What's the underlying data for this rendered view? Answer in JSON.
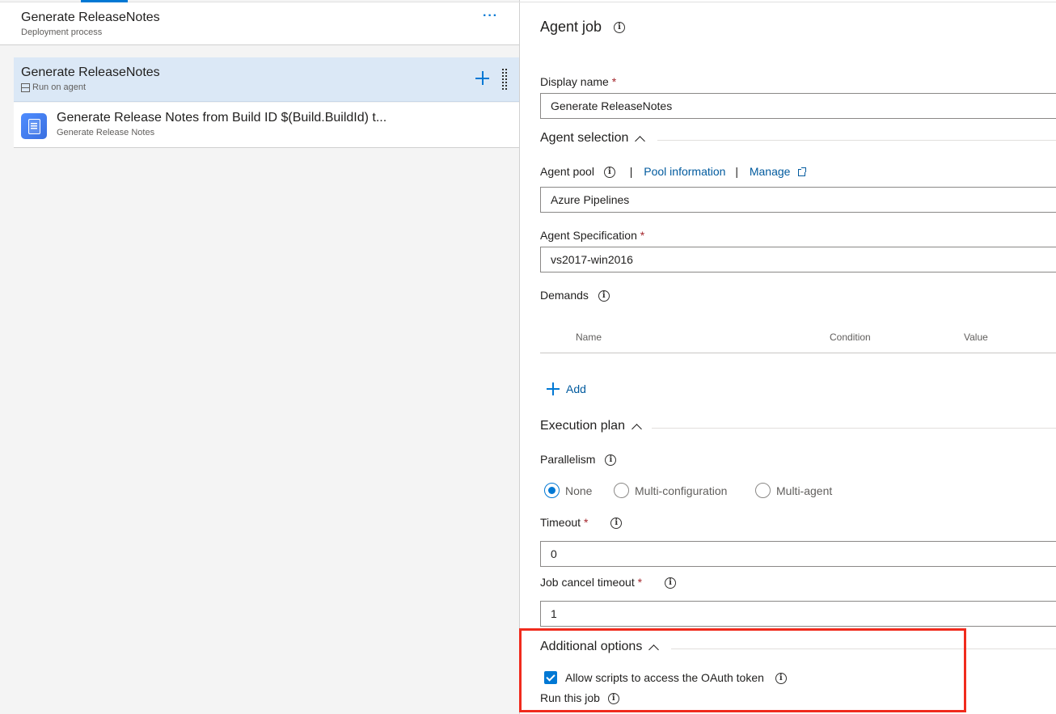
{
  "left_pane": {
    "process_title": "Generate ReleaseNotes",
    "process_subtitle": "Deployment process",
    "more_label": "···",
    "job": {
      "title": "Generate ReleaseNotes",
      "subtitle": "Run on agent"
    },
    "task": {
      "title": "Generate Release Notes from Build ID $(Build.BuildId) t...",
      "subtitle": "Generate Release Notes"
    }
  },
  "right_pane": {
    "heading": "Agent job",
    "display_name": {
      "label": "Display name",
      "required_mark": "*",
      "value": "Generate ReleaseNotes"
    },
    "agent_selection": {
      "title": "Agent selection",
      "agent_pool_label": "Agent pool",
      "separator": "|",
      "pool_information_link": "Pool information",
      "manage_link": "Manage",
      "agent_pool_value": "Azure Pipelines",
      "agent_spec_label": "Agent Specification",
      "agent_spec_value": "vs2017-win2016",
      "demands_label": "Demands",
      "demands_columns": [
        "Name",
        "Condition",
        "Value"
      ],
      "add_label": "Add"
    },
    "execution_plan": {
      "title": "Execution plan",
      "parallelism_label": "Parallelism",
      "options": [
        "None",
        "Multi-configuration",
        "Multi-agent"
      ],
      "selected": "None",
      "timeout_label": "Timeout",
      "timeout_value": "0",
      "cancel_timeout_label": "Job cancel timeout",
      "cancel_timeout_value": "1"
    },
    "additional_options": {
      "title": "Additional options",
      "oauth_label": "Allow scripts to access the OAuth token",
      "oauth_checked": true,
      "run_this_job_label": "Run this job"
    }
  },
  "colors": {
    "accent": "#0078d4",
    "selected_row": "#dbe8f6",
    "highlight_box": "#f02b1d",
    "required": "#a4262c"
  }
}
